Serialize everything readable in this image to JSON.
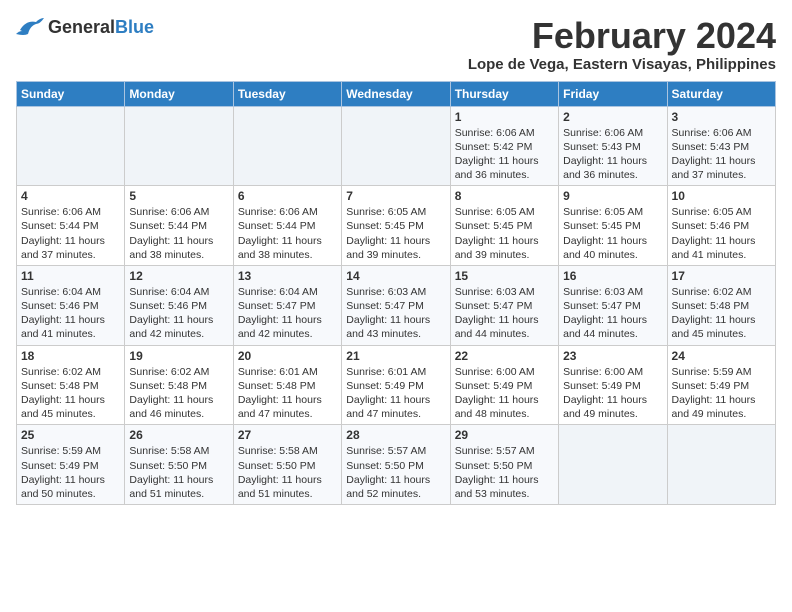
{
  "logo": {
    "text_general": "General",
    "text_blue": "Blue"
  },
  "title": "February 2024",
  "subtitle": "Lope de Vega, Eastern Visayas, Philippines",
  "days_of_week": [
    "Sunday",
    "Monday",
    "Tuesday",
    "Wednesday",
    "Thursday",
    "Friday",
    "Saturday"
  ],
  "weeks": [
    [
      {
        "day": "",
        "info": ""
      },
      {
        "day": "",
        "info": ""
      },
      {
        "day": "",
        "info": ""
      },
      {
        "day": "",
        "info": ""
      },
      {
        "day": "1",
        "info": "Sunrise: 6:06 AM\nSunset: 5:42 PM\nDaylight: 11 hours\nand 36 minutes."
      },
      {
        "day": "2",
        "info": "Sunrise: 6:06 AM\nSunset: 5:43 PM\nDaylight: 11 hours\nand 36 minutes."
      },
      {
        "day": "3",
        "info": "Sunrise: 6:06 AM\nSunset: 5:43 PM\nDaylight: 11 hours\nand 37 minutes."
      }
    ],
    [
      {
        "day": "4",
        "info": "Sunrise: 6:06 AM\nSunset: 5:44 PM\nDaylight: 11 hours\nand 37 minutes."
      },
      {
        "day": "5",
        "info": "Sunrise: 6:06 AM\nSunset: 5:44 PM\nDaylight: 11 hours\nand 38 minutes."
      },
      {
        "day": "6",
        "info": "Sunrise: 6:06 AM\nSunset: 5:44 PM\nDaylight: 11 hours\nand 38 minutes."
      },
      {
        "day": "7",
        "info": "Sunrise: 6:05 AM\nSunset: 5:45 PM\nDaylight: 11 hours\nand 39 minutes."
      },
      {
        "day": "8",
        "info": "Sunrise: 6:05 AM\nSunset: 5:45 PM\nDaylight: 11 hours\nand 39 minutes."
      },
      {
        "day": "9",
        "info": "Sunrise: 6:05 AM\nSunset: 5:45 PM\nDaylight: 11 hours\nand 40 minutes."
      },
      {
        "day": "10",
        "info": "Sunrise: 6:05 AM\nSunset: 5:46 PM\nDaylight: 11 hours\nand 41 minutes."
      }
    ],
    [
      {
        "day": "11",
        "info": "Sunrise: 6:04 AM\nSunset: 5:46 PM\nDaylight: 11 hours\nand 41 minutes."
      },
      {
        "day": "12",
        "info": "Sunrise: 6:04 AM\nSunset: 5:46 PM\nDaylight: 11 hours\nand 42 minutes."
      },
      {
        "day": "13",
        "info": "Sunrise: 6:04 AM\nSunset: 5:47 PM\nDaylight: 11 hours\nand 42 minutes."
      },
      {
        "day": "14",
        "info": "Sunrise: 6:03 AM\nSunset: 5:47 PM\nDaylight: 11 hours\nand 43 minutes."
      },
      {
        "day": "15",
        "info": "Sunrise: 6:03 AM\nSunset: 5:47 PM\nDaylight: 11 hours\nand 44 minutes."
      },
      {
        "day": "16",
        "info": "Sunrise: 6:03 AM\nSunset: 5:47 PM\nDaylight: 11 hours\nand 44 minutes."
      },
      {
        "day": "17",
        "info": "Sunrise: 6:02 AM\nSunset: 5:48 PM\nDaylight: 11 hours\nand 45 minutes."
      }
    ],
    [
      {
        "day": "18",
        "info": "Sunrise: 6:02 AM\nSunset: 5:48 PM\nDaylight: 11 hours\nand 45 minutes."
      },
      {
        "day": "19",
        "info": "Sunrise: 6:02 AM\nSunset: 5:48 PM\nDaylight: 11 hours\nand 46 minutes."
      },
      {
        "day": "20",
        "info": "Sunrise: 6:01 AM\nSunset: 5:48 PM\nDaylight: 11 hours\nand 47 minutes."
      },
      {
        "day": "21",
        "info": "Sunrise: 6:01 AM\nSunset: 5:49 PM\nDaylight: 11 hours\nand 47 minutes."
      },
      {
        "day": "22",
        "info": "Sunrise: 6:00 AM\nSunset: 5:49 PM\nDaylight: 11 hours\nand 48 minutes."
      },
      {
        "day": "23",
        "info": "Sunrise: 6:00 AM\nSunset: 5:49 PM\nDaylight: 11 hours\nand 49 minutes."
      },
      {
        "day": "24",
        "info": "Sunrise: 5:59 AM\nSunset: 5:49 PM\nDaylight: 11 hours\nand 49 minutes."
      }
    ],
    [
      {
        "day": "25",
        "info": "Sunrise: 5:59 AM\nSunset: 5:49 PM\nDaylight: 11 hours\nand 50 minutes."
      },
      {
        "day": "26",
        "info": "Sunrise: 5:58 AM\nSunset: 5:50 PM\nDaylight: 11 hours\nand 51 minutes."
      },
      {
        "day": "27",
        "info": "Sunrise: 5:58 AM\nSunset: 5:50 PM\nDaylight: 11 hours\nand 51 minutes."
      },
      {
        "day": "28",
        "info": "Sunrise: 5:57 AM\nSunset: 5:50 PM\nDaylight: 11 hours\nand 52 minutes."
      },
      {
        "day": "29",
        "info": "Sunrise: 5:57 AM\nSunset: 5:50 PM\nDaylight: 11 hours\nand 53 minutes."
      },
      {
        "day": "",
        "info": ""
      },
      {
        "day": "",
        "info": ""
      }
    ]
  ]
}
